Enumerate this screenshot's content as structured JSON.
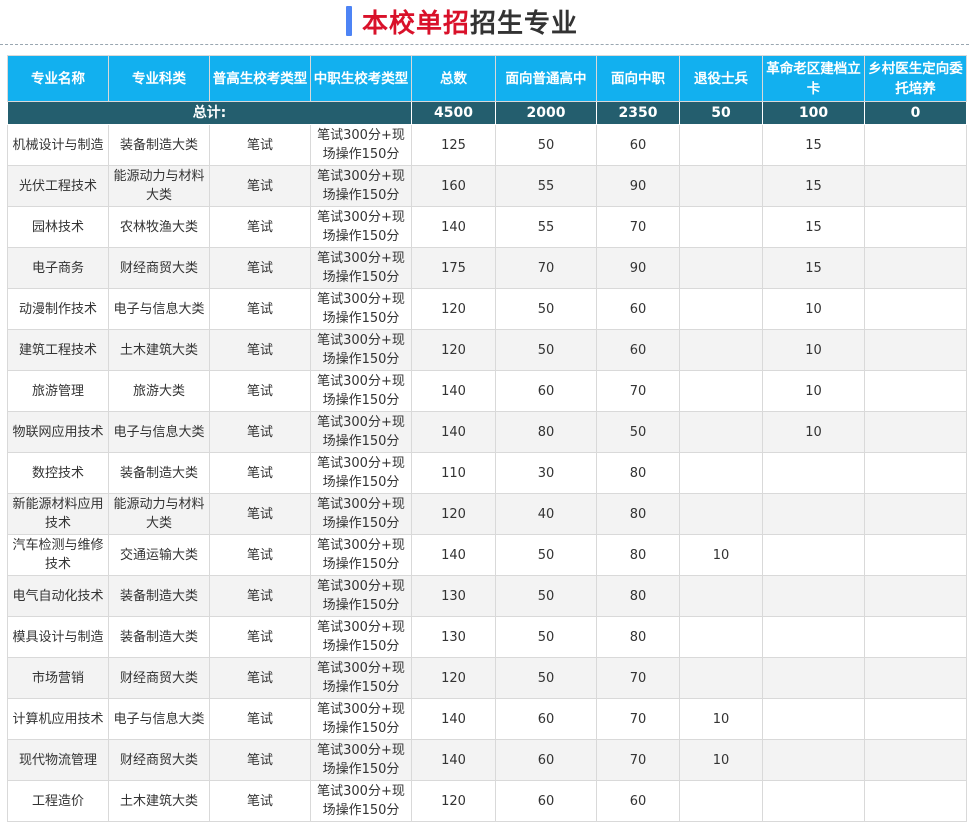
{
  "title": {
    "highlight": "本校单招",
    "rest": "招生专业"
  },
  "colors": {
    "accent": "#4d84f5",
    "title_red": "#d9112a",
    "header_bg": "#12b0ef",
    "total_bg": "#245e6e"
  },
  "table": {
    "headers": [
      "专业名称",
      "专业科类",
      "普高生校考类型",
      "中职生校考类型",
      "总数",
      "面向普通高中",
      "面向中职",
      "退役士兵",
      "革命老区建档立卡",
      "乡村医生定向委托培养"
    ],
    "total_label": "总计:",
    "totals": [
      "4500",
      "2000",
      "2350",
      "50",
      "100",
      "0"
    ],
    "rows": [
      [
        "机械设计与制造",
        "装备制造大类",
        "笔试",
        "笔试300分+现场操作150分",
        "125",
        "50",
        "60",
        "",
        "15",
        ""
      ],
      [
        "光伏工程技术",
        "能源动力与材料大类",
        "笔试",
        "笔试300分+现场操作150分",
        "160",
        "55",
        "90",
        "",
        "15",
        ""
      ],
      [
        "园林技术",
        "农林牧渔大类",
        "笔试",
        "笔试300分+现场操作150分",
        "140",
        "55",
        "70",
        "",
        "15",
        ""
      ],
      [
        "电子商务",
        "财经商贸大类",
        "笔试",
        "笔试300分+现场操作150分",
        "175",
        "70",
        "90",
        "",
        "15",
        ""
      ],
      [
        "动漫制作技术",
        "电子与信息大类",
        "笔试",
        "笔试300分+现场操作150分",
        "120",
        "50",
        "60",
        "",
        "10",
        ""
      ],
      [
        "建筑工程技术",
        "土木建筑大类",
        "笔试",
        "笔试300分+现场操作150分",
        "120",
        "50",
        "60",
        "",
        "10",
        ""
      ],
      [
        "旅游管理",
        "旅游大类",
        "笔试",
        "笔试300分+现场操作150分",
        "140",
        "60",
        "70",
        "",
        "10",
        ""
      ],
      [
        "物联网应用技术",
        "电子与信息大类",
        "笔试",
        "笔试300分+现场操作150分",
        "140",
        "80",
        "50",
        "",
        "10",
        ""
      ],
      [
        "数控技术",
        "装备制造大类",
        "笔试",
        "笔试300分+现场操作150分",
        "110",
        "30",
        "80",
        "",
        "",
        ""
      ],
      [
        "新能源材料应用技术",
        "能源动力与材料大类",
        "笔试",
        "笔试300分+现场操作150分",
        "120",
        "40",
        "80",
        "",
        "",
        ""
      ],
      [
        "汽车检测与维修技术",
        "交通运输大类",
        "笔试",
        "笔试300分+现场操作150分",
        "140",
        "50",
        "80",
        "10",
        "",
        ""
      ],
      [
        "电气自动化技术",
        "装备制造大类",
        "笔试",
        "笔试300分+现场操作150分",
        "130",
        "50",
        "80",
        "",
        "",
        ""
      ],
      [
        "模具设计与制造",
        "装备制造大类",
        "笔试",
        "笔试300分+现场操作150分",
        "130",
        "50",
        "80",
        "",
        "",
        ""
      ],
      [
        "市场营销",
        "财经商贸大类",
        "笔试",
        "笔试300分+现场操作150分",
        "120",
        "50",
        "70",
        "",
        "",
        ""
      ],
      [
        "计算机应用技术",
        "电子与信息大类",
        "笔试",
        "笔试300分+现场操作150分",
        "140",
        "60",
        "70",
        "10",
        "",
        ""
      ],
      [
        "现代物流管理",
        "财经商贸大类",
        "笔试",
        "笔试300分+现场操作150分",
        "140",
        "60",
        "70",
        "10",
        "",
        ""
      ],
      [
        "工程造价",
        "土木建筑大类",
        "笔试",
        "笔试300分+现场操作150分",
        "120",
        "60",
        "60",
        "",
        "",
        ""
      ]
    ]
  }
}
